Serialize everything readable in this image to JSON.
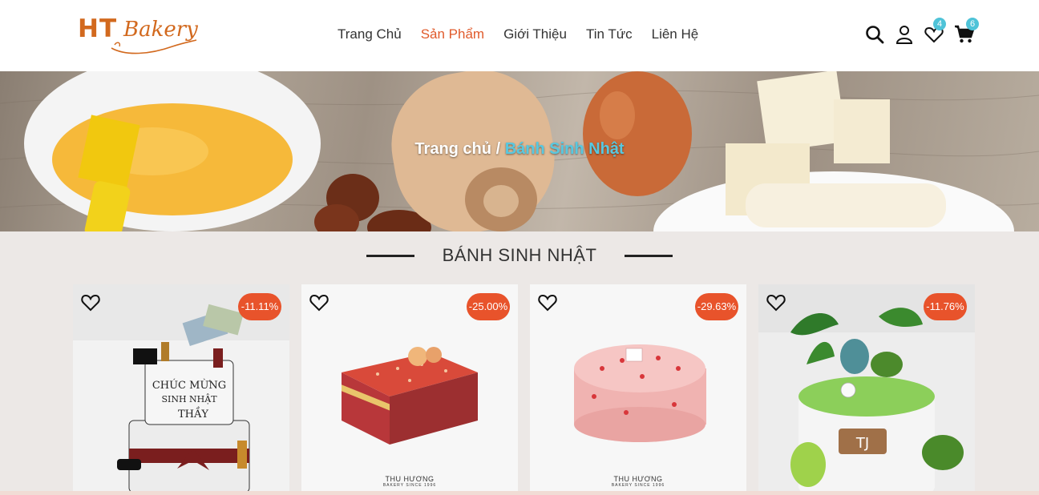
{
  "logo": {
    "ht": "HT",
    "bakery": "Bakery"
  },
  "nav": {
    "items": [
      {
        "label": "Trang Chủ",
        "active": false
      },
      {
        "label": "Sản Phẩm",
        "active": true
      },
      {
        "label": "Giới Thiệu",
        "active": false
      },
      {
        "label": "Tin Tức",
        "active": false
      },
      {
        "label": "Liên Hệ",
        "active": false
      }
    ]
  },
  "header_icons": {
    "search": "search-icon",
    "user": "user-icon",
    "wishlist": {
      "icon": "heart-icon",
      "count": "4"
    },
    "cart": {
      "icon": "cart-icon",
      "count": "6"
    }
  },
  "banner": {
    "breadcrumb_home": "Trang chủ",
    "breadcrumb_sep": "/",
    "breadcrumb_current": "Bánh Sinh Nhật"
  },
  "section": {
    "title": "BÁNH SINH NHẬT"
  },
  "products": [
    {
      "discount": "-11.11%",
      "brand": ""
    },
    {
      "discount": "-25.00%",
      "brand": "THU HƯƠNG",
      "brand_sub": "BAKERY SINCE 1996"
    },
    {
      "discount": "-29.63%",
      "brand": "THU HƯƠNG",
      "brand_sub": "BAKERY SINCE 1996"
    },
    {
      "discount": "-11.76%",
      "brand": ""
    }
  ],
  "colors": {
    "accent": "#e05a2b",
    "badge": "#4fc3d8",
    "discount": "#e8532b",
    "breadcrumb_current": "#58c8e0"
  }
}
